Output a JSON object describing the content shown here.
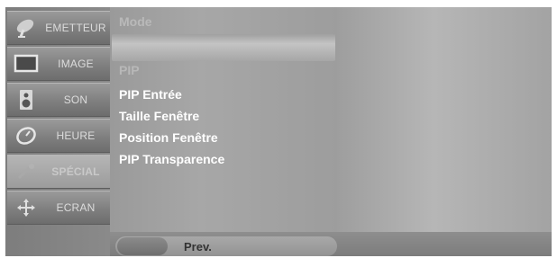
{
  "sidebar": {
    "items": [
      {
        "label": "EMETTEUR",
        "icon": "satellite-dish-icon"
      },
      {
        "label": "IMAGE",
        "icon": "screen-icon"
      },
      {
        "label": "SON",
        "icon": "speaker-icon"
      },
      {
        "label": "HEURE",
        "icon": "clock-icon"
      },
      {
        "label": "SPÉCIAL",
        "icon": "special-icon"
      },
      {
        "label": "ECRAN",
        "icon": "cross-arrows-icon"
      }
    ],
    "active_index": 4
  },
  "menu": {
    "header": "Mode",
    "items": [
      {
        "label": "PIP"
      },
      {
        "label": "PIP Entrée"
      },
      {
        "label": "Taille Fenêtre"
      },
      {
        "label": "Position Fenêtre"
      },
      {
        "label": "PIP Transparence"
      }
    ]
  },
  "footer": {
    "prev_label": "Prev."
  }
}
